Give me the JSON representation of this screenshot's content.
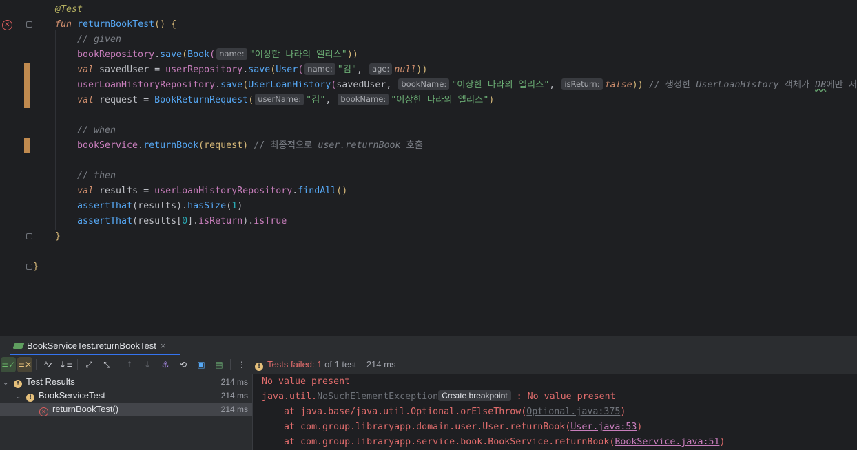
{
  "editor": {
    "annotation": "@Test",
    "fun_kw": "fun",
    "fun_name": "returnBookTest",
    "fun_parens": "()",
    "open_brace": "{",
    "comment_given": "// given",
    "l1": {
      "recv": "bookRepository",
      "dot": ".",
      "method": "save",
      "open": "(",
      "cls": "Book",
      "cls_open": "(",
      "hint_name": "name:",
      "str": "\"이상한 나라의 엘리스\"",
      "close": "))"
    },
    "l2": {
      "val": "val",
      "var": " savedUser = ",
      "recv": "userRepository",
      "method": "save",
      "cls": "User",
      "hint_name": "name:",
      "str": "\"김\"",
      "comma": ", ",
      "hint_age": "age:",
      "null": "null",
      "close": "))"
    },
    "l3": {
      "recv": "userLoanHistoryRepository",
      "method": "save",
      "cls": "UserLoanHistory",
      "arg1": "savedUser, ",
      "hint_book": "bookName:",
      "str": "\"이상한 나라의 엘리스\"",
      "comma": ", ",
      "hint_ret": "isReturn:",
      "false": "false",
      "close": "))",
      "comment_a": "// 생성한 ",
      "comment_b": "UserLoanHistory",
      "comment_c": " 객체가 ",
      "comment_d": "DB",
      "comment_e": "에만 저장됨"
    },
    "l4": {
      "val": "val",
      "var": " request = ",
      "cls": "BookReturnRequest",
      "hint_user": "userName:",
      "str_user": "\"김\"",
      "comma": ", ",
      "hint_book": "bookName:",
      "str_book": "\"이상한 나라의 엘리스\"",
      "close": ")"
    },
    "comment_when": "// when",
    "l5": {
      "recv": "bookService",
      "method": "returnBook",
      "args": "(request)",
      "comment_a": " // 최종적으로 ",
      "comment_b": "user.returnBook",
      "comment_c": " 호출"
    },
    "comment_then": "// then",
    "l6": {
      "val": "val",
      "var": " results = ",
      "recv": "userLoanHistoryRepository",
      "method": "findAll",
      "parens": "()"
    },
    "l7": {
      "fn": "assertThat",
      "args": "(results)",
      "dot": ".",
      "method": "hasSize",
      "open": "(",
      "num": "1",
      "close": ")"
    },
    "l8": {
      "fn": "assertThat",
      "args1": "(results[",
      "num": "0",
      "args2": "].",
      "prop": "isReturn",
      "close": ").",
      "prop2": "isTrue"
    },
    "close_fun": "}",
    "close_class": "}"
  },
  "run_panel": {
    "tab_title": "BookServiceTest.returnBookTest",
    "tab_close": "×",
    "status_prefix": "Tests failed: ",
    "status_failed": "1",
    "status_suffix": " of 1 test",
    "status_time": " – 214 ms",
    "tree": [
      {
        "label": "Test Results",
        "time": "214 ms"
      },
      {
        "label": "BookServiceTest",
        "time": "214 ms"
      },
      {
        "label": "returnBookTest()",
        "time": "214 ms"
      }
    ],
    "console": {
      "line1": "No value present",
      "line2_a": "java.util.",
      "line2_exc": "NoSuchElementException",
      "line2_bp": "Create breakpoint",
      "line2_b": " : No value present",
      "line3_a": "    at java.base/java.util.Optional.orElseThrow(",
      "line3_link": "Optional.java:375",
      "line3_b": ")",
      "line4_a": "    at com.group.libraryapp.domain.user.User.returnBook(",
      "line4_link": "User.java:53",
      "line4_b": ")",
      "line5_a": "    at com.group.libraryapp.service.book.BookService.returnBook(",
      "line5_link": "BookService.java:51",
      "line5_b": ")"
    }
  }
}
